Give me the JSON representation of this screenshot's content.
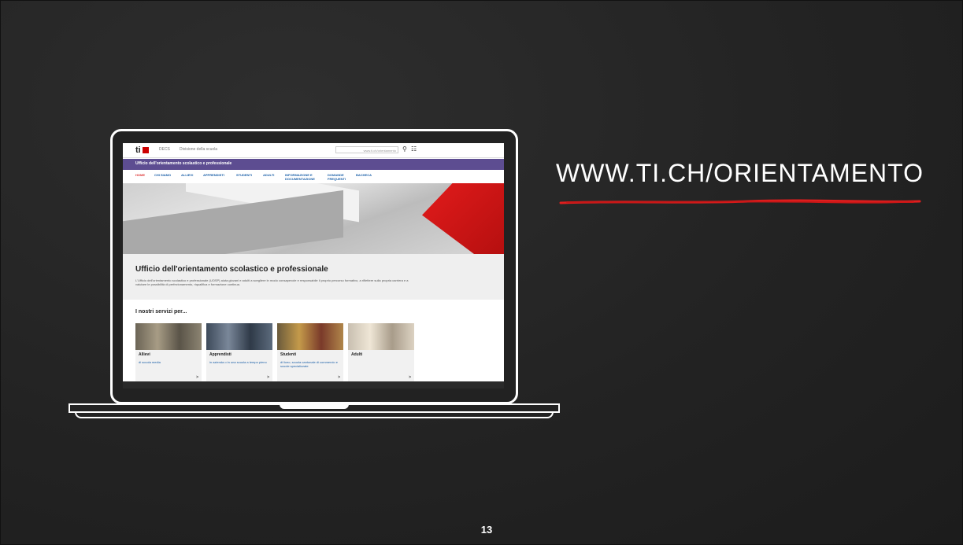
{
  "slide": {
    "url_title": "WWW.TI.CH/ORIENTAMENTO",
    "page_number": "13",
    "accent_color": "#e01e1e"
  },
  "website": {
    "logo": "ti",
    "breadcrumb": [
      "DECS",
      "Divisione della scuola"
    ],
    "search_placeholder": "www.ti.ch/orientamento",
    "department": "Ufficio dell'orientamento scolastico e professionale",
    "nav": [
      "HOME",
      "CHI SIAMO",
      "ALLIEVI",
      "APPRENDISTI",
      "STUDENTI",
      "ADULTI",
      "INFORMAZIONE E DOCUMENTAZIONE",
      "DOMANDE FREQUENTI",
      "BACHECA"
    ],
    "intro_title": "Ufficio dell'orientamento scolastico e professionale",
    "intro_text": "L'Ufficio dell'orientamento scolastico e professionale (UOSP) aiuta giovani e adulti a scegliere in modo consapevole e responsabile il proprio percorso formativo, a riflettere sulla propria carriera e a valutare le possibilità di perfezionamento, riqualifica e formazione continua.",
    "services_title": "I nostri servizi per...",
    "cards": [
      {
        "title": "Allievi",
        "subtitle": "di scuola media"
      },
      {
        "title": "Apprendisti",
        "subtitle": "in azienda o in una scuola a tempo pieno"
      },
      {
        "title": "Studenti",
        "subtitle": "di liceo, scuola cantonale di commercio e scuole specializzate"
      },
      {
        "title": "Adulti",
        "subtitle": ""
      }
    ]
  }
}
